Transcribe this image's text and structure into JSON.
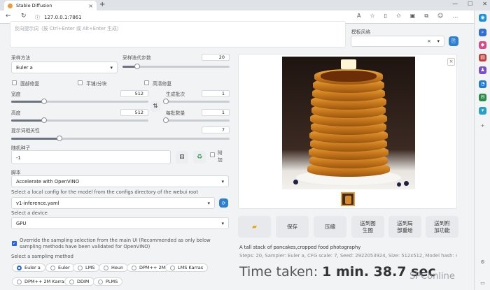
{
  "browser": {
    "tab_title": "Stable Diffusion",
    "url": "127.0.0.1:7861"
  },
  "prompt": {
    "negative_placeholder": "反向提示词（按 Ctrl+Enter 或 Alt+Enter 生成）"
  },
  "style": {
    "label": "模板风格"
  },
  "sampler": {
    "label": "采样方法",
    "value": "Euler a"
  },
  "steps": {
    "label": "采样迭代步数",
    "value": "20"
  },
  "checks": {
    "face_restore": "面部修复",
    "tiling": "平铺/分块",
    "hires": "高清修复"
  },
  "width": {
    "label": "宽度",
    "value": "512"
  },
  "height": {
    "label": "高度",
    "value": "512"
  },
  "batch_count": {
    "label": "生成批次",
    "value": "1"
  },
  "batch_size": {
    "label": "每批数量",
    "value": "1"
  },
  "cfg": {
    "label": "提示词相关性",
    "value": "7"
  },
  "seed": {
    "label": "随机种子",
    "value": "-1",
    "extra": "附加"
  },
  "script": {
    "label": "脚本",
    "value": "Accelerate with OpenVINO",
    "config_hint": "Select a local config for the model from the configs directory of the webui root",
    "config_value": "v1-inference.yaml",
    "device_hint": "Select a device",
    "device_value": "GPU",
    "override_text": "Override the sampling selection from the main UI (Recommended as only below sampling methods have been validated for OpenVINO)",
    "method_hint": "Select a sampling method",
    "methods": [
      "Euler a",
      "Euler",
      "LMS",
      "Heun",
      "DPM++ 2M",
      "LMS Karras",
      "DPM++ 2M Karras",
      "DDIM",
      "PLMS"
    ]
  },
  "actions": {
    "folder_icon": "folder-icon",
    "save": "保存",
    "zip": "压缩",
    "to_img2img": "送到图\n生图",
    "to_inpaint": "送到局\n部重绘",
    "to_extras": "送到附\n加功能"
  },
  "output": {
    "caption": "A tall stack of pancakes,cropped food photography",
    "params_line": "Steps: 20, Sampler: Euler a, CFG scale: 7, Seed: 2922053924, Size: 512x512, Model hash: 4c86efd062, Model: v1-",
    "time_label": "Time taken: ",
    "time_value": "1 min. 38.7 sec",
    "watermark": "SPConline"
  }
}
